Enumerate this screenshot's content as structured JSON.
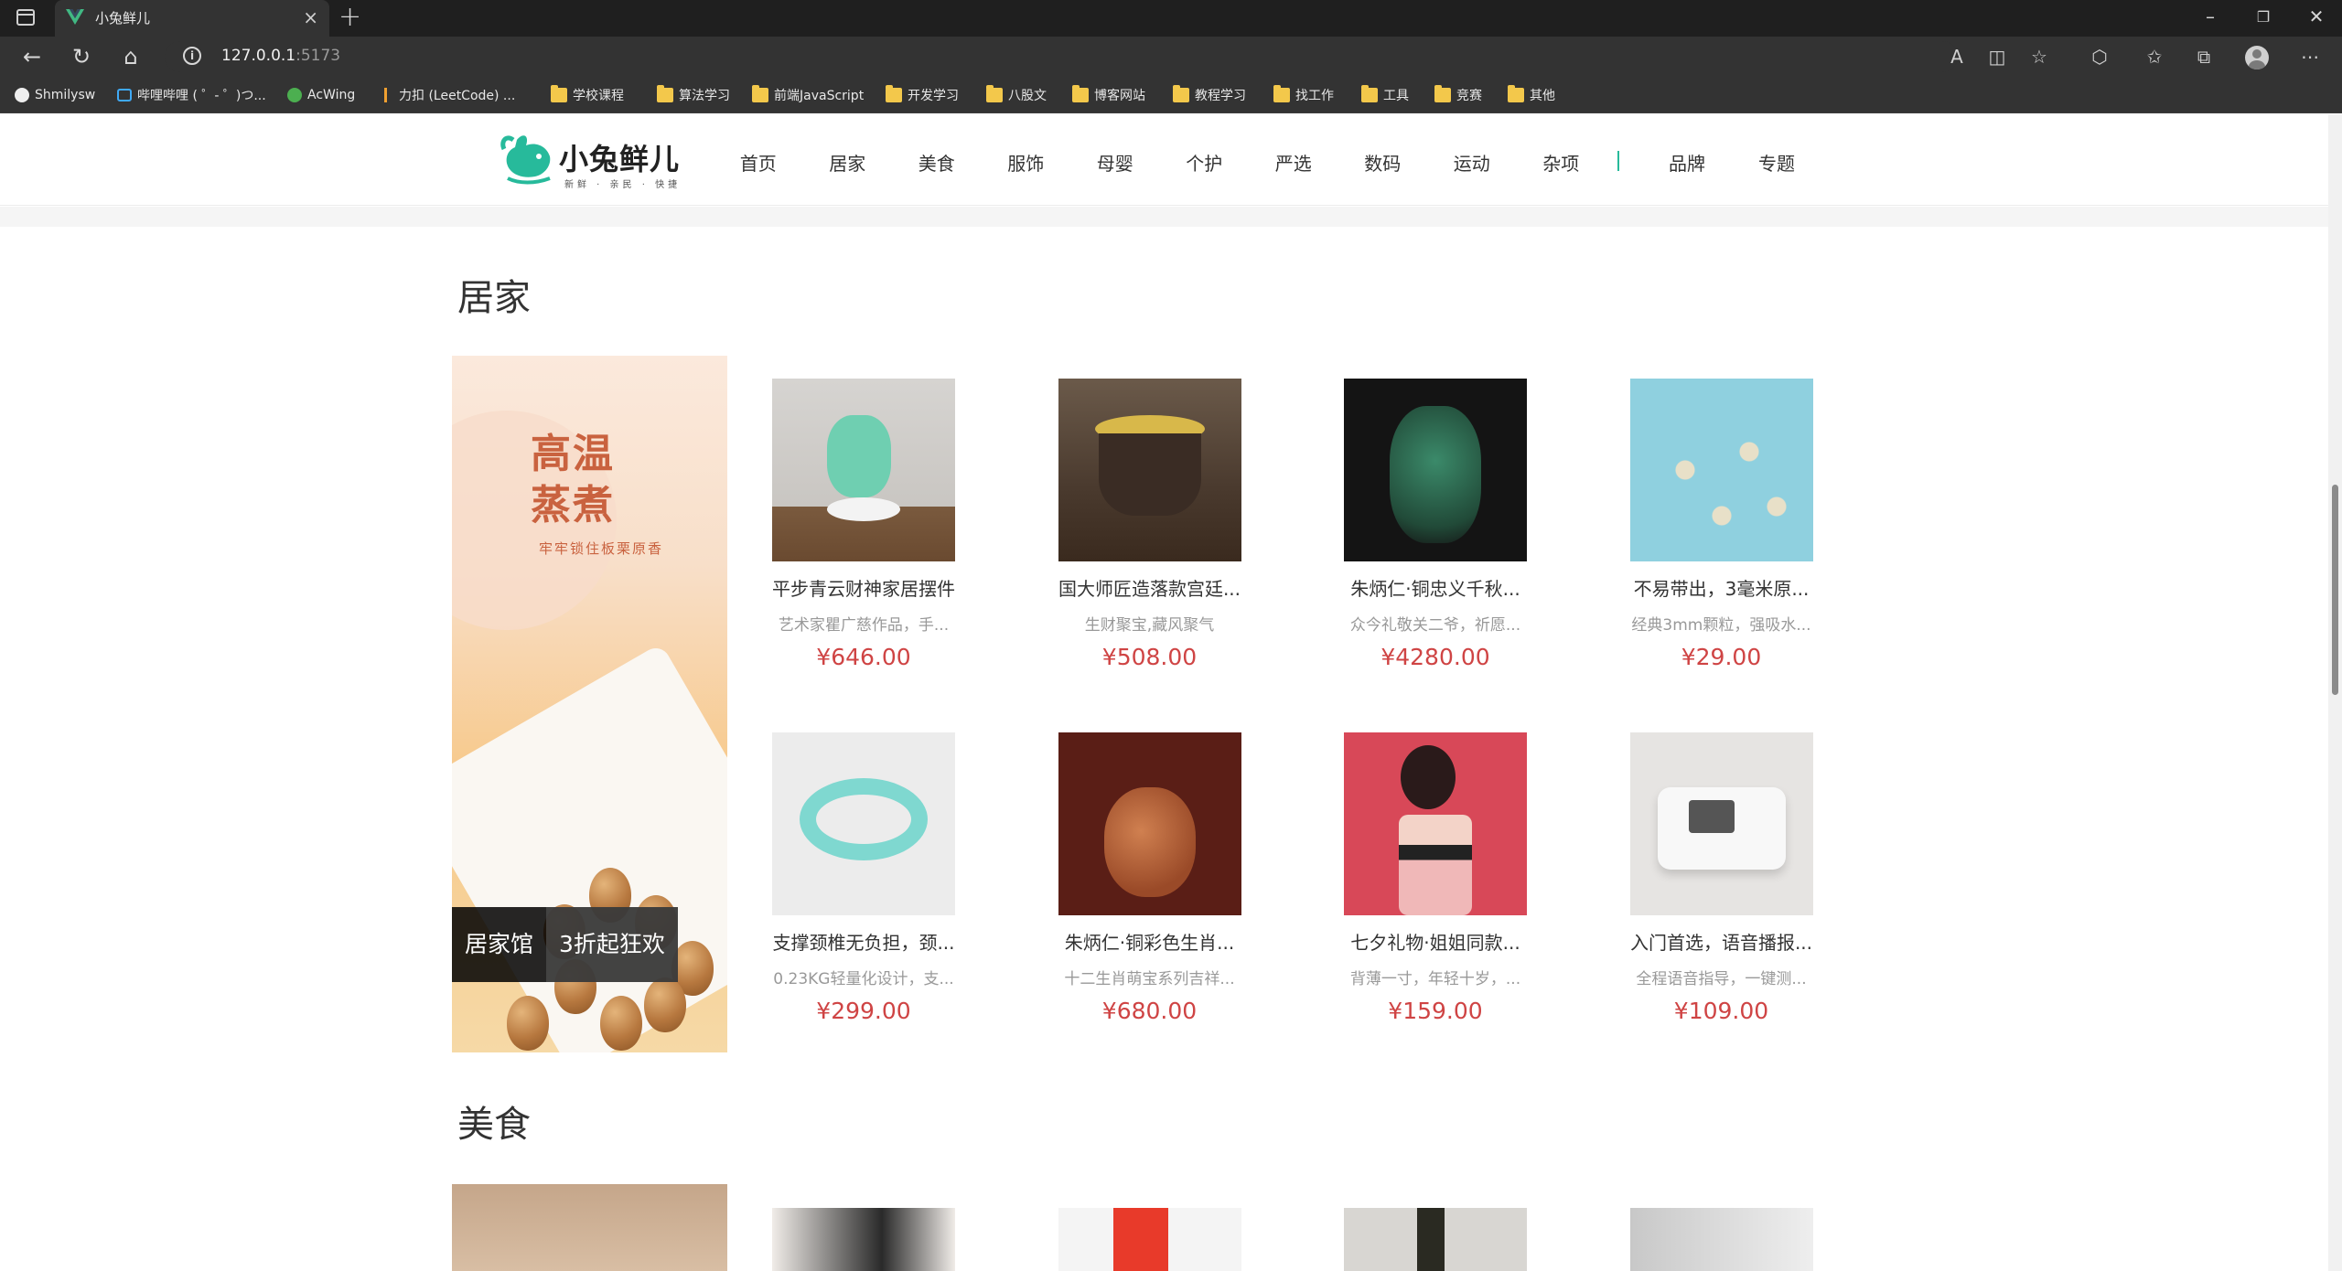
{
  "browser": {
    "tab_title": "小兔鲜儿",
    "url_host": "127.0.0.1",
    "url_port": ":5173",
    "bookmarks": [
      "Shmilysw",
      "哔哩哔哩 ( ゜- ゜)つ...",
      "AcWing",
      "力扣 (LeetCode) ...",
      "学校课程",
      "算法学习",
      "前端JavaScript",
      "开发学习",
      "八股文",
      "博客网站",
      "教程学习",
      "找工作",
      "工具",
      "竞赛",
      "其他"
    ]
  },
  "header": {
    "logo_text": "小兔鲜儿",
    "logo_sub": "新鲜 · 亲民 · 快捷",
    "nav": [
      "首页",
      "居家",
      "美食",
      "服饰",
      "母婴",
      "个护",
      "严选",
      "数码",
      "运动",
      "杂项"
    ],
    "nav_extra": [
      "品牌",
      "专题"
    ]
  },
  "section_home": {
    "title": "居家",
    "promo_stamp": [
      "高温",
      "蒸煮"
    ],
    "promo_sub": "牢牢锁住板栗原香",
    "promo_label": [
      "居家馆",
      "3折起狂欢"
    ],
    "products": [
      {
        "name": "平步青云财神家居摆件",
        "desc": "艺术家瞿广慈作品，手...",
        "price": "¥646.00"
      },
      {
        "name": "国大师匠造落款宫廷...",
        "desc": "生财聚宝,藏风聚气",
        "price": "¥508.00"
      },
      {
        "name": "朱炳仁·铜忠义千秋...",
        "desc": "众今礼敬关二爷，祈愿...",
        "price": "¥4280.00"
      },
      {
        "name": "不易带出，3毫米原...",
        "desc": "经典3mm颗粒，强吸水...",
        "price": "¥29.00"
      },
      {
        "name": "支撑颈椎无负担，颈...",
        "desc": "0.23KG轻量化设计，支...",
        "price": "¥299.00"
      },
      {
        "name": "朱炳仁·铜彩色生肖...",
        "desc": "十二生肖萌宝系列吉祥...",
        "price": "¥680.00"
      },
      {
        "name": "七夕礼物·姐姐同款...",
        "desc": "背薄一寸，年轻十岁，...",
        "price": "¥159.00"
      },
      {
        "name": "入门首选，语音播报...",
        "desc": "全程语音指导，一键测...",
        "price": "¥109.00"
      }
    ]
  },
  "section_food": {
    "title": "美食"
  },
  "colors": {
    "brand_green": "#27ba9b",
    "price_red": "#cf4444"
  }
}
